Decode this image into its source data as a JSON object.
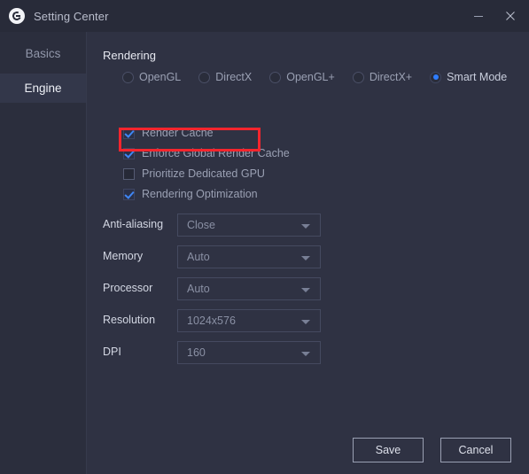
{
  "window": {
    "title": "Setting Center",
    "icon": "app-logo-icon",
    "controls": {
      "minimize": "minimize-icon",
      "close": "close-icon"
    }
  },
  "sidebar": {
    "items": [
      {
        "label": "Basics",
        "active": false
      },
      {
        "label": "Engine",
        "active": true
      }
    ]
  },
  "main": {
    "section_title": "Rendering",
    "radios": [
      {
        "label": "OpenGL",
        "checked": false
      },
      {
        "label": "DirectX",
        "checked": false
      },
      {
        "label": "OpenGL+",
        "checked": false
      },
      {
        "label": "DirectX+",
        "checked": false
      },
      {
        "label": "Smart Mode",
        "checked": true
      }
    ],
    "checkboxes": [
      {
        "label": "Render Cache",
        "checked": true
      },
      {
        "label": "Enforce Global Render Cache",
        "checked": true
      },
      {
        "label": "Prioritize Dedicated GPU",
        "checked": false,
        "highlighted": true
      },
      {
        "label": "Rendering Optimization",
        "checked": true
      }
    ],
    "fields": [
      {
        "label": "Anti-aliasing",
        "value": "Close"
      },
      {
        "label": "Memory",
        "value": "Auto"
      },
      {
        "label": "Processor",
        "value": "Auto"
      },
      {
        "label": "Resolution",
        "value": "1024x576"
      },
      {
        "label": "DPI",
        "value": "160"
      }
    ]
  },
  "footer": {
    "save_label": "Save",
    "cancel_label": "Cancel"
  },
  "colors": {
    "window_bg": "#2f3243",
    "titlebar_bg": "#282b39",
    "sidebar_bg": "#2b2e3d",
    "accent_blue": "#2e7dff",
    "highlight_red": "#f5252d"
  }
}
